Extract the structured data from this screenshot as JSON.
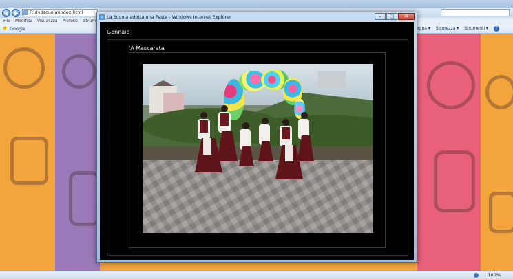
{
  "browser": {
    "address": "F:\\dvdscuola\\index.html",
    "menu": [
      "File",
      "Modifica",
      "Visualizza",
      "Preferiti",
      "Strumenti"
    ],
    "favorites": {
      "google_label": "Google"
    },
    "command_bar": {
      "page": "Pagina ▾",
      "security": "Sicurezza ▾",
      "tools": "Strumenti ▾",
      "help": "?"
    },
    "status": {
      "zoom": "100%"
    },
    "nav_icons": [
      "back-icon",
      "forward-icon"
    ]
  },
  "popup": {
    "title": "La Scuola adotta una Feste - Windows Internet Explorer",
    "controls": {
      "minimize": "–",
      "maximize": "□",
      "close": "✕"
    },
    "month": "Gennaio",
    "event_title": "'A Mascarata"
  },
  "colors": {
    "page_stripes": [
      "#f3a43c",
      "#9b79b8",
      "#e8607a",
      "#f3a43c"
    ],
    "content_bg": "#000000"
  }
}
